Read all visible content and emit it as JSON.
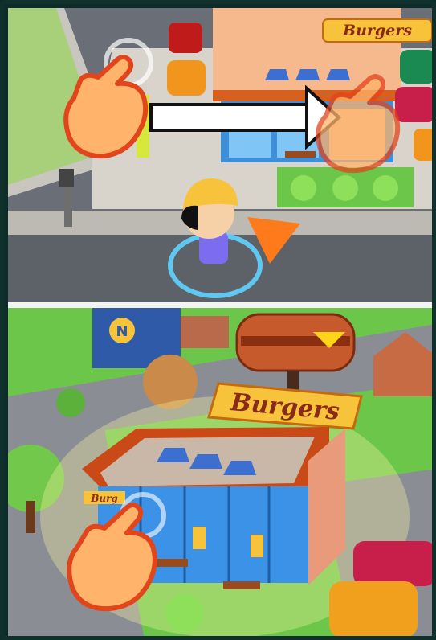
{
  "tutorial": {
    "top_panel": {
      "sign_text": "Burgers",
      "hint": "drag-right",
      "player_character": "boy-with-yellow-cap",
      "direction_pointer": "orange-arrow"
    },
    "bottom_panel": {
      "sign_text": "Burgers",
      "small_sign_text": "Burg",
      "hint": "tap",
      "badge": "N"
    }
  },
  "icons": [
    "tap-hand-icon",
    "swipe-arrow-icon",
    "direction-pointer-icon",
    "burger-icon"
  ],
  "colors": {
    "road": "#5d6168",
    "grass": "#6cc64a",
    "building_roof": "#f6b98d",
    "building_trim": "#b94a16",
    "glass": "#4fa6e8",
    "sign_yellow": "#f7c33a",
    "sign_text": "#8a2a1a",
    "hand_fill": "#ffb36b",
    "hand_outline": "#e2441c",
    "pointer_orange": "#ff7a1a",
    "ring_blue": "#5fd3ff"
  }
}
